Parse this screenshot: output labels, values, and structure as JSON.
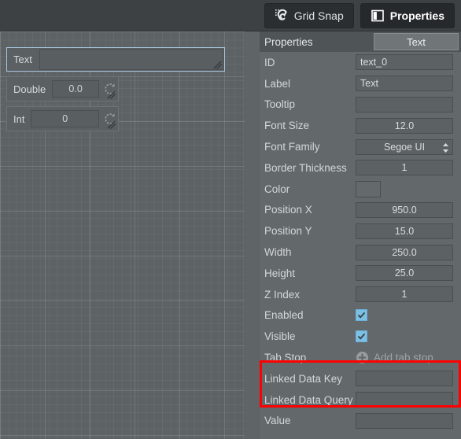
{
  "toolbar": {
    "buttons": [
      {
        "label": "Grid Snap",
        "icon": "grid-snap-magnet-icon",
        "active": false
      },
      {
        "label": "Properties",
        "icon": "properties-panel-icon",
        "active": true
      }
    ]
  },
  "canvas": {
    "widgets": [
      {
        "label": "Text",
        "value": "",
        "type": "text",
        "selected": true
      },
      {
        "label": "Double",
        "value": "0.0",
        "type": "double",
        "selected": false
      },
      {
        "label": "Int",
        "value": "0",
        "type": "int",
        "selected": false
      }
    ],
    "scrollbar": {
      "arrow_icon": "scroll-up-arrow-icon"
    }
  },
  "properties": {
    "header_title": "Properties",
    "tab_label": "Text",
    "rows": [
      {
        "label": "ID",
        "value": "text_0",
        "kind": "text-left"
      },
      {
        "label": "Label",
        "value": "Text",
        "kind": "text-left"
      },
      {
        "label": "Tooltip",
        "value": "",
        "kind": "text-left"
      },
      {
        "label": "Font Size",
        "value": "12.0",
        "kind": "number"
      },
      {
        "label": "Font Family",
        "value": "Segoe UI",
        "kind": "dropdown"
      },
      {
        "label": "Border Thickness",
        "value": "1",
        "kind": "number"
      },
      {
        "label": "Color",
        "value": "",
        "kind": "color",
        "swatch": "#64696c"
      },
      {
        "label": "Position X",
        "value": "950.0",
        "kind": "number"
      },
      {
        "label": "Position Y",
        "value": "15.0",
        "kind": "number"
      },
      {
        "label": "Width",
        "value": "250.0",
        "kind": "number"
      },
      {
        "label": "Height",
        "value": "25.0",
        "kind": "number"
      },
      {
        "label": "Z Index",
        "value": "1",
        "kind": "number"
      },
      {
        "label": "Enabled",
        "value": "",
        "kind": "checkbox",
        "checked": true
      },
      {
        "label": "Visible",
        "value": "",
        "kind": "checkbox",
        "checked": true
      },
      {
        "label": "Tab Stop",
        "value": "Add tab stop",
        "kind": "action"
      },
      {
        "label": "Linked Data Key",
        "value": "",
        "kind": "text-left"
      },
      {
        "label": "Linked Data Query",
        "value": "",
        "kind": "text-left"
      },
      {
        "label": "Value",
        "value": "",
        "kind": "text-left"
      }
    ]
  },
  "annotation": {
    "highlight_color": "#ff0000"
  }
}
